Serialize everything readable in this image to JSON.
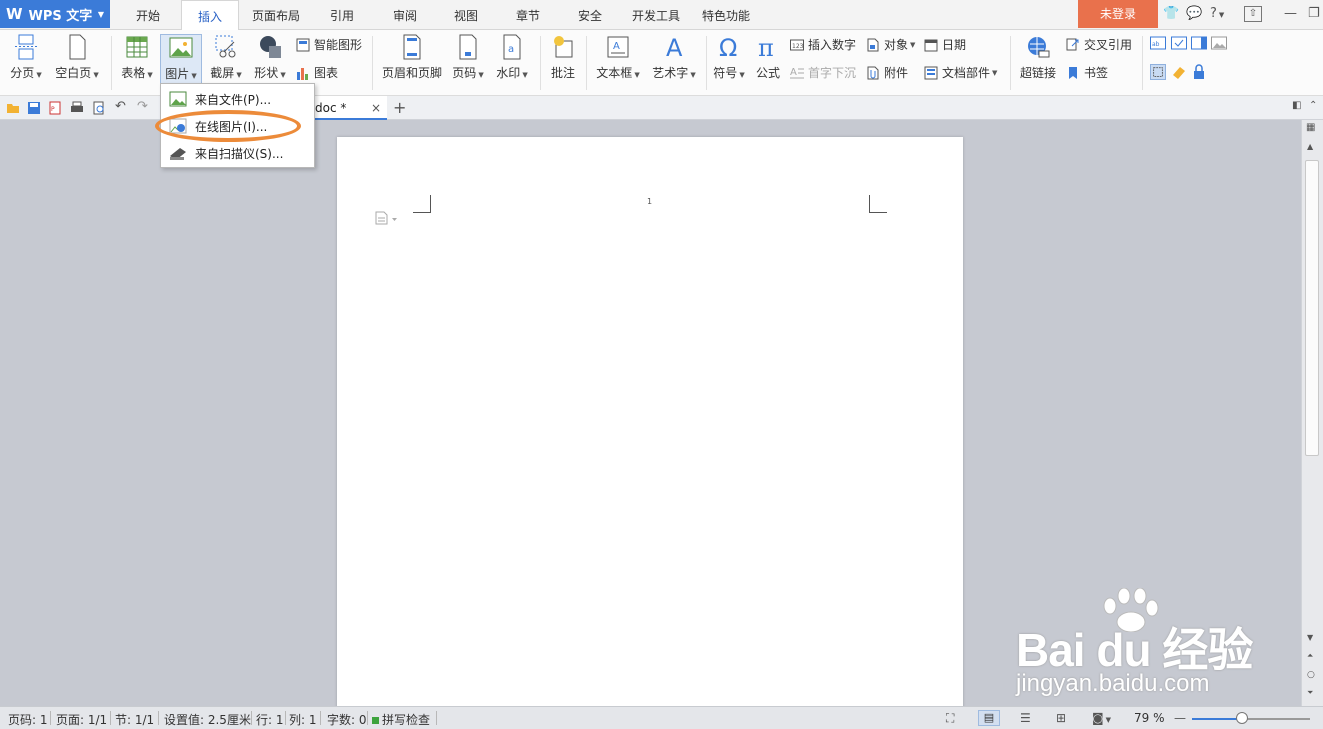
{
  "app": {
    "name": "WPS 文字"
  },
  "tabs": [
    "开始",
    "插入",
    "页面布局",
    "引用",
    "审阅",
    "视图",
    "章节",
    "安全",
    "开发工具",
    "特色功能"
  ],
  "active_tab": "插入",
  "login": "未登录",
  "help": "?",
  "ribbon": {
    "page_break": "分页",
    "blank_page": "空白页",
    "table": "表格",
    "picture": "图片",
    "screenshot": "截屏",
    "shape": "形状",
    "smart_art": "智能图形",
    "chart": "图表",
    "header_footer": "页眉和页脚",
    "page_number": "页码",
    "watermark": "水印",
    "comment": "批注",
    "textbox": "文本框",
    "wordart": "艺术字",
    "symbol": "符号",
    "formula": "公式",
    "insert_number": "插入数字",
    "drop_cap": "首字下沉",
    "object": "对象",
    "attachment": "附件",
    "date": "日期",
    "doc_parts": "文档部件",
    "hyperlink": "超链接",
    "cross_ref": "交叉引用",
    "bookmark": "书签"
  },
  "doc_tab": {
    "name": "doc *"
  },
  "picture_menu": {
    "items": [
      "来自文件(P)...",
      "在线图片(I)...",
      "来自扫描仪(S)..."
    ]
  },
  "page": {
    "number": "1"
  },
  "statusbar": {
    "page_code": "页码: 1",
    "page": "页面: 1/1",
    "section": "节: 1/1",
    "setting": "设置值: 2.5厘米",
    "row": "行: 1",
    "col": "列: 1",
    "word_count": "字数: 0",
    "spell_check": "拼写检查",
    "zoom": "79 %"
  },
  "watermark": {
    "main": "Bai du 经验",
    "sub": "jingyan.baidu.com"
  },
  "colors": {
    "accent": "#3b7bd8",
    "login": "#e9714c",
    "highlight": "#ec8b3a"
  }
}
